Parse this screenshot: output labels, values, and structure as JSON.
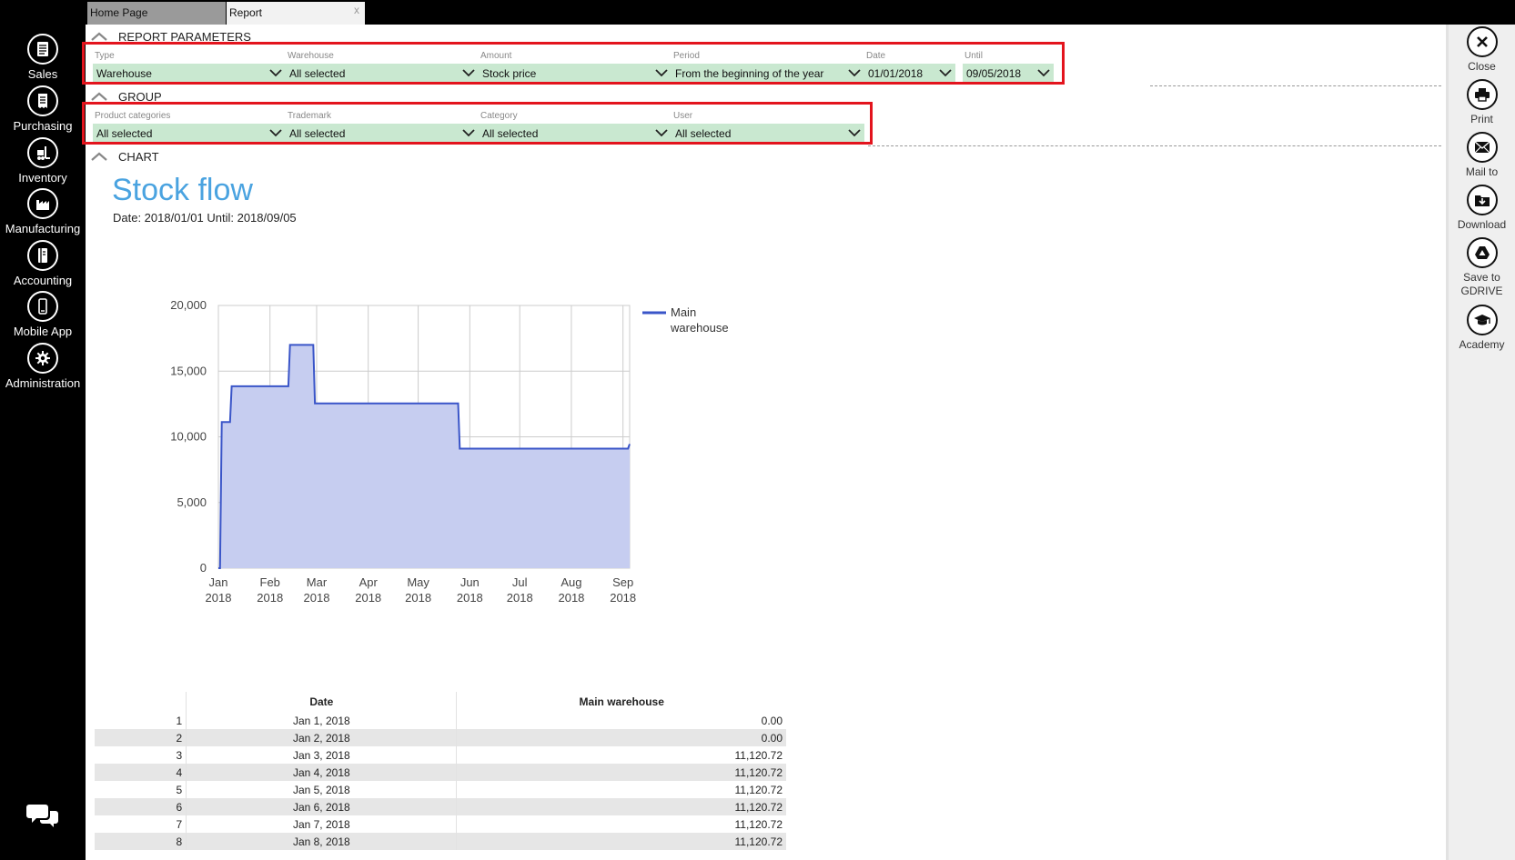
{
  "tabs": [
    {
      "label": "Home Page"
    },
    {
      "label": "Report",
      "close": "x"
    }
  ],
  "sidebar": {
    "items": [
      {
        "label": "Sales",
        "icon": "document-icon"
      },
      {
        "label": "Purchasing",
        "icon": "receipt-icon"
      },
      {
        "label": "Inventory",
        "icon": "forklift-icon"
      },
      {
        "label": "Manufacturing",
        "icon": "factory-icon"
      },
      {
        "label": "Accounting",
        "icon": "ledger-icon"
      },
      {
        "label": "Mobile App",
        "icon": "phone-icon"
      },
      {
        "label": "Administration",
        "icon": "gear-icon"
      }
    ],
    "chat_icon": "chat-icon"
  },
  "sections": {
    "report_parameters": "REPORT PARAMETERS",
    "group": "GROUP",
    "chart": "CHART"
  },
  "params": [
    {
      "label": "Type",
      "value": "Warehouse"
    },
    {
      "label": "Warehouse",
      "value": "All selected"
    },
    {
      "label": "Amount",
      "value": "Stock price"
    },
    {
      "label": "Period",
      "value": "From the beginning of the year"
    },
    {
      "label": "Date",
      "value": "01/01/2018"
    },
    {
      "label": "Until",
      "value": "09/05/2018"
    }
  ],
  "group": [
    {
      "label": "Product categories",
      "value": "All selected"
    },
    {
      "label": "Trademark",
      "value": "All selected"
    },
    {
      "label": "Category",
      "value": "All selected"
    },
    {
      "label": "User",
      "value": "All selected"
    }
  ],
  "report": {
    "title": "Stock flow",
    "subtitle": "Date: 2018/01/01 Until: 2018/09/05"
  },
  "chart_data": {
    "type": "area",
    "title": "",
    "xlabel": "",
    "ylabel": "",
    "series": [
      {
        "name": "Main warehouse",
        "color": "#3a55c8",
        "fill": "#c6cdf0",
        "x": [
          "2018-01-01",
          "2018-01-02",
          "2018-01-03",
          "2018-01-08",
          "2018-01-09",
          "2018-02-12",
          "2018-02-13",
          "2018-02-27",
          "2018-02-28",
          "2018-05-25",
          "2018-05-26",
          "2018-09-04",
          "2018-09-05"
        ],
        "values": [
          0,
          0,
          11120.72,
          11120.72,
          13850,
          13850,
          17000,
          17000,
          12550,
          12550,
          9100,
          9100,
          9450
        ]
      }
    ],
    "ylim": [
      0,
      20000
    ],
    "yticks": [
      "20,000",
      "15,000",
      "10,000",
      "5,000",
      "0"
    ],
    "xticks": [
      {
        "m": "Jan",
        "y": "2018"
      },
      {
        "m": "Feb",
        "y": "2018"
      },
      {
        "m": "Mar",
        "y": "2018"
      },
      {
        "m": "Apr",
        "y": "2018"
      },
      {
        "m": "May",
        "y": "2018"
      },
      {
        "m": "Jun",
        "y": "2018"
      },
      {
        "m": "Jul",
        "y": "2018"
      },
      {
        "m": "Aug",
        "y": "2018"
      },
      {
        "m": "Sep",
        "y": "2018"
      }
    ],
    "legend": {
      "position": "right",
      "label_line1": "Main",
      "label_line2": "warehouse"
    },
    "grid": true
  },
  "table": {
    "headers": [
      "",
      "Date",
      "Main warehouse"
    ],
    "rows": [
      [
        "1",
        "Jan 1, 2018",
        "0.00"
      ],
      [
        "2",
        "Jan 2, 2018",
        "0.00"
      ],
      [
        "3",
        "Jan 3, 2018",
        "11,120.72"
      ],
      [
        "4",
        "Jan 4, 2018",
        "11,120.72"
      ],
      [
        "5",
        "Jan 5, 2018",
        "11,120.72"
      ],
      [
        "6",
        "Jan 6, 2018",
        "11,120.72"
      ],
      [
        "7",
        "Jan 7, 2018",
        "11,120.72"
      ],
      [
        "8",
        "Jan 8, 2018",
        "11,120.72"
      ]
    ]
  },
  "toolbar": {
    "items": [
      {
        "label": "Close",
        "icon": "close-icon"
      },
      {
        "label": "Print",
        "icon": "print-icon"
      },
      {
        "label": "Mail to",
        "icon": "mail-icon"
      },
      {
        "label": "Download",
        "icon": "download-icon"
      },
      {
        "label": "Save to GDRIVE",
        "icon": "google-drive-icon"
      },
      {
        "label": "Academy",
        "icon": "graduation-cap-icon"
      }
    ]
  }
}
